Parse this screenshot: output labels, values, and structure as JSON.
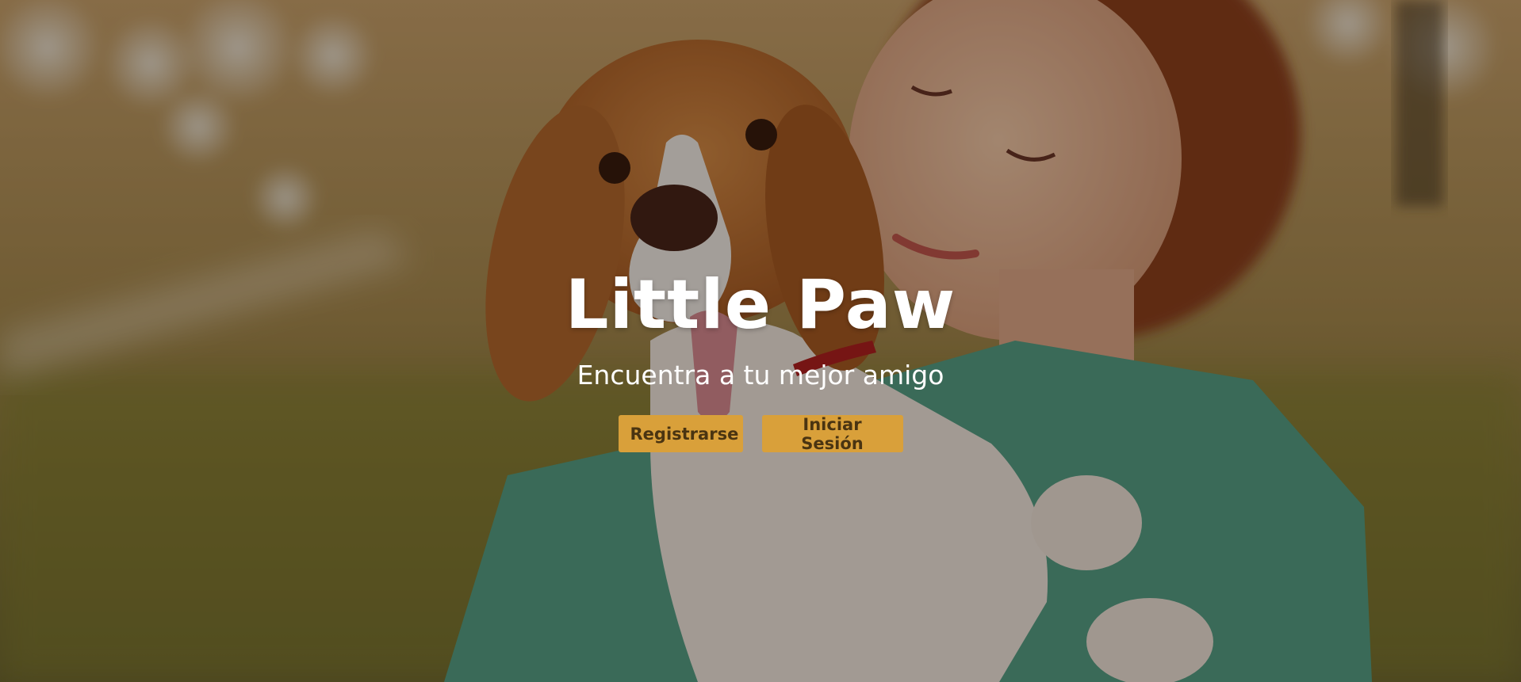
{
  "hero": {
    "title": "Little Paw",
    "subtitle": "Encuentra a tu mejor amigo",
    "buttons": {
      "register_label": "Registrarse",
      "login_label": "Iniciar Sesión"
    },
    "background_icon": "woman-hugging-dog-photo"
  },
  "colors": {
    "button_bg": "#d9a03a",
    "button_text": "#4a3411",
    "title_text": "#ffffff",
    "sweater_green": "#5fa58a",
    "dog_brown": "#b8692c"
  }
}
